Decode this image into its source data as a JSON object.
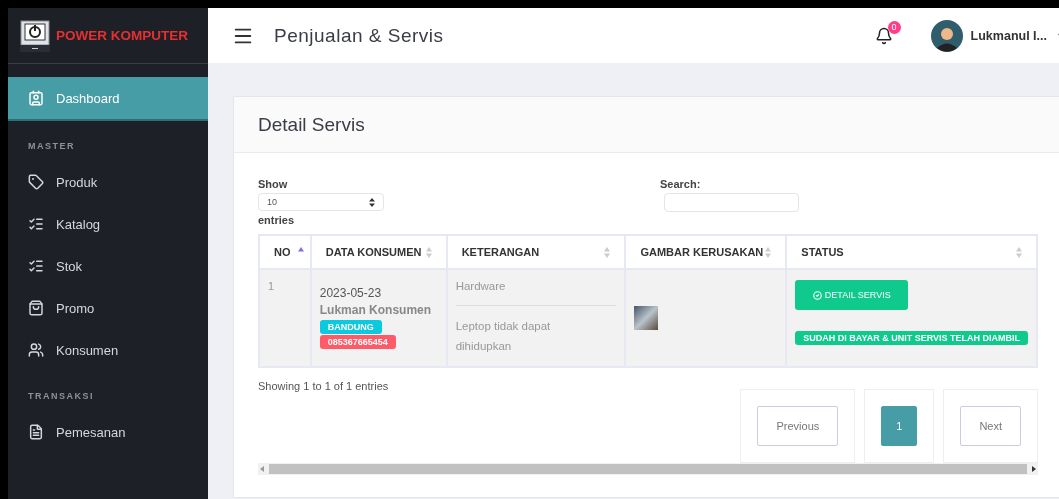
{
  "brand": {
    "name": "POWER KOMPUTER"
  },
  "sidebar": {
    "sections": [
      {
        "items": [
          {
            "label": "Dashboard",
            "selected": true
          }
        ]
      },
      {
        "heading": "MASTER",
        "items": [
          {
            "label": "Produk",
            "selected": false
          },
          {
            "label": "Katalog",
            "selected": false
          },
          {
            "label": "Stok",
            "selected": false
          },
          {
            "label": "Promo",
            "selected": false
          },
          {
            "label": "Konsumen",
            "selected": false
          }
        ]
      },
      {
        "heading": "TRANSAKSI",
        "items": [
          {
            "label": "Pemesanan",
            "selected": false
          }
        ]
      }
    ]
  },
  "header": {
    "title": "Penjualan & Servis",
    "notification_count": "0",
    "user": {
      "name": "Lukmanul I..."
    }
  },
  "card": {
    "title": "Detail Servis",
    "show_label": "Show",
    "length_value": "10",
    "entries_label": "entries",
    "search_label": "Search:",
    "table": {
      "columns": [
        {
          "label": "NO",
          "sorted": true
        },
        {
          "label": "DATA KONSUMEN",
          "sorted": false
        },
        {
          "label": "KETERANGAN",
          "sorted": false
        },
        {
          "label": "GAMBAR KERUSAKAN",
          "sorted": false
        },
        {
          "label": "STATUS",
          "sorted": false
        }
      ],
      "rows": [
        {
          "no": "1",
          "date": "2023-05-23",
          "name": "Lukman Konsumen",
          "city": "BANDUNG",
          "phone": "085367665454",
          "category": "Hardware",
          "description": "Leptop tidak dapat dihidupkan",
          "action": "DETAIL SERVIS",
          "status": "SUDAH DI BAYAR & UNIT SERVIS TELAH DIAMBIL"
        }
      ]
    },
    "info": "Showing 1 to 1 of 1 entries",
    "pagination": [
      {
        "label": "Previous",
        "selected": false
      },
      {
        "label": "1",
        "selected": true
      },
      {
        "label": "Next",
        "selected": false
      }
    ]
  }
}
